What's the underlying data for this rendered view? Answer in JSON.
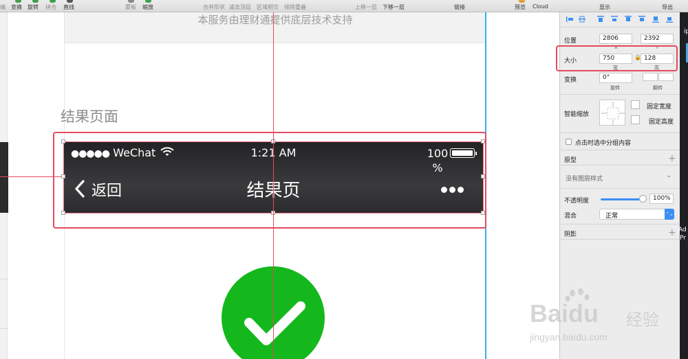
{
  "toolbar": {
    "items": [
      "编",
      "变换",
      "旋转",
      "拼合",
      "直线",
      "蒙板",
      "缩放",
      "合并形状",
      "减去顶层",
      "区域相交",
      "排除重叠",
      "上移一层",
      "下移一层",
      "链接",
      "预览",
      "Cloud",
      "显示",
      "导出"
    ]
  },
  "canvas": {
    "footer_text": "本服务由理财通提供底层技术支持",
    "artboard_title": "结果页面",
    "status_bar": {
      "dots": "●●●●●",
      "carrier": "WeChat",
      "time": "1:21 AM",
      "battery_text": "100 %"
    },
    "nav": {
      "back_label": "返回",
      "title": "结果页"
    },
    "colors": {
      "selection": "#e34a5e",
      "guide_blue": "#36aee2",
      "success": "#14b81c",
      "nav_bg": "#2c2c2e"
    }
  },
  "inspector": {
    "position_label": "位置",
    "x_value": "2806",
    "y_value": "2392",
    "x_sub": "X",
    "y_sub": "Y",
    "size_label": "大小",
    "width_value": "750",
    "height_value": "128",
    "width_sub": "宽",
    "height_sub": "高",
    "transform_label": "变换",
    "rotation_value": "0°",
    "rotate_sub": "旋转",
    "flip_sub": "翻转",
    "smart_resize_label": "智能缩放",
    "fix_width_label": "固定宽度",
    "fix_height_label": "固定高度",
    "click_select_label": "点击时选中分组内容",
    "prototype_label": "原型",
    "no_style_label": "没有图层样式",
    "opacity_label": "不透明度",
    "opacity_value": "100%",
    "opacity_fraction": 1.0,
    "blend_label": "混合",
    "blend_value": "正常",
    "shadow_label": "阴影"
  },
  "right_strip": {
    "top_text": "ip",
    "mid_text_1": "Ad",
    "mid_text_2": "Pr"
  },
  "watermark": {
    "brand": "Baidu",
    "sub": "经验",
    "url": "jingyan.baidu.com"
  }
}
